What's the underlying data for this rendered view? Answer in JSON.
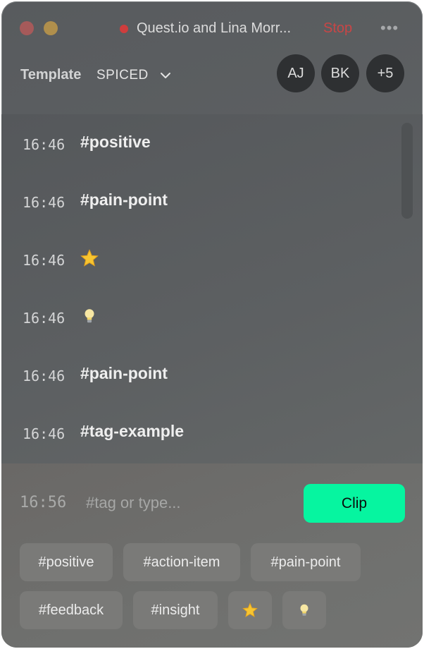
{
  "titlebar": {
    "title": "Quest.io and Lina Morr...",
    "stop_label": "Stop",
    "more_label": "•••"
  },
  "template": {
    "label": "Template",
    "value": "SPICED"
  },
  "participants": [
    "AJ",
    "BK",
    "+5"
  ],
  "entries": [
    {
      "time": "16:46",
      "tag": "#positive"
    },
    {
      "time": "16:46",
      "tag": "#pain-point"
    },
    {
      "time": "16:46",
      "icon": "star-icon"
    },
    {
      "time": "16:46",
      "icon": "lightbulb-icon"
    },
    {
      "time": "16:46",
      "tag": "#pain-point"
    },
    {
      "time": "16:46",
      "tag": "#tag-example"
    }
  ],
  "composer": {
    "time": "16:56",
    "placeholder": "#tag or type...",
    "clip_label": "Clip"
  },
  "quick_tags": [
    "#positive",
    "#action-item",
    "#pain-point",
    "#feedback",
    "#insight"
  ],
  "quick_icons": [
    "star-icon",
    "lightbulb-icon"
  ],
  "colors": {
    "accent": "#06f5a0",
    "record": "#cf3d3d",
    "stop": "#c84646"
  }
}
